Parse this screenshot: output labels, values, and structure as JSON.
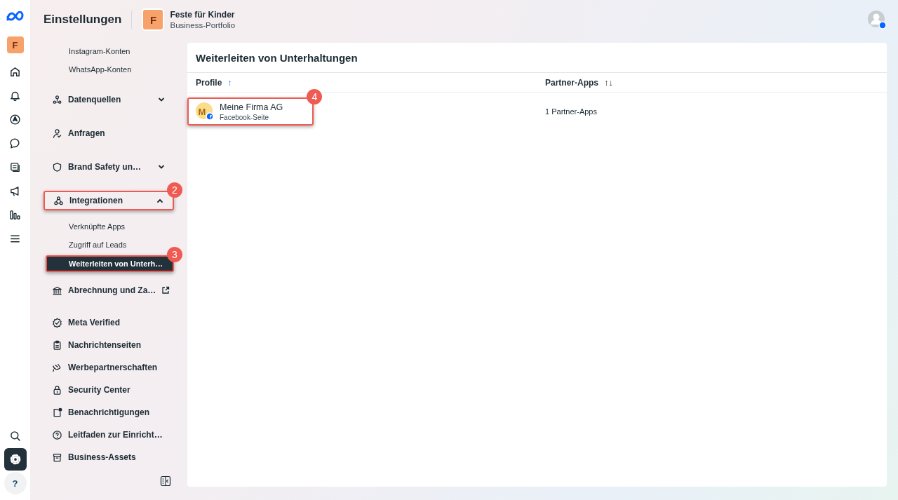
{
  "rail": {
    "avatar_letter": "F",
    "items": [
      {
        "kind": "home",
        "selected": false
      },
      {
        "kind": "bell",
        "selected": false
      },
      {
        "kind": "compass",
        "selected": false
      },
      {
        "kind": "chat",
        "selected": false
      },
      {
        "kind": "pages",
        "selected": false
      },
      {
        "kind": "megaphone",
        "selected": false
      },
      {
        "kind": "chart",
        "selected": false
      },
      {
        "kind": "menu",
        "selected": false
      }
    ],
    "bottom_items": [
      {
        "kind": "search",
        "selected": false
      },
      {
        "kind": "settings",
        "selected": true
      },
      {
        "kind": "help",
        "label": "?",
        "selected": false
      }
    ]
  },
  "header": {
    "title": "Einstellungen",
    "business": {
      "letter": "F",
      "name": "Feste für Kinder",
      "subtitle": "Business-Portfolio"
    }
  },
  "sidebar": {
    "sections": [
      {
        "items": [
          {
            "kind": "sub",
            "label": "Instagram-Konten",
            "selected": false
          },
          {
            "kind": "sub",
            "label": "WhatsApp-Konten",
            "selected": false
          }
        ]
      },
      {
        "items": [
          {
            "kind": "datasources",
            "label": "Datenquellen",
            "expanded": false,
            "selected": false
          },
          {
            "kind": "requests",
            "label": "Anfragen",
            "selected": false
          },
          {
            "kind": "shield",
            "label": "Brand Safety un…",
            "expanded": false,
            "selected": false
          },
          {
            "kind": "integrations",
            "label": "Integrationen",
            "expanded": true,
            "selected": false,
            "callout": "2",
            "children": [
              {
                "kind": "sub",
                "label": "Verknüpfte Apps",
                "selected": false
              },
              {
                "kind": "sub",
                "label": "Zugriff auf Leads",
                "selected": false
              },
              {
                "kind": "sub",
                "label": "Weiterleiten von Unterh…",
                "selected": true,
                "callout": "3"
              }
            ]
          },
          {
            "kind": "bank",
            "label": "Abrechnung und Za…",
            "external": true,
            "selected": false
          }
        ]
      },
      {
        "items": [
          {
            "kind": "verified",
            "label": "Meta Verified",
            "selected": false
          },
          {
            "kind": "clipboard",
            "label": "Nachrichtenseiten",
            "selected": false
          },
          {
            "kind": "partnership",
            "label": "Werbepartnerschaften",
            "selected": false
          },
          {
            "kind": "lock",
            "label": "Security Center",
            "selected": false
          },
          {
            "kind": "notification",
            "label": "Benachrichtigungen",
            "selected": false
          },
          {
            "kind": "guide",
            "label": "Leitfaden zur Einricht…",
            "selected": false
          },
          {
            "kind": "archive",
            "label": "Business-Assets",
            "selected": false
          }
        ]
      }
    ]
  },
  "panel": {
    "title": "Weiterleiten von Unterhaltungen",
    "table": {
      "columns": [
        {
          "label": "Profile",
          "sort_indicator": "↑",
          "sorted": true
        },
        {
          "label": "Partner-Apps",
          "sort_indicator": "↑↓",
          "sorted": false
        }
      ],
      "rows": [
        {
          "avatar": "M",
          "name": "Meine Firma AG",
          "type": "Facebook-Seite",
          "partner_apps": "1 Partner-Apps",
          "callout": "4"
        }
      ]
    }
  }
}
